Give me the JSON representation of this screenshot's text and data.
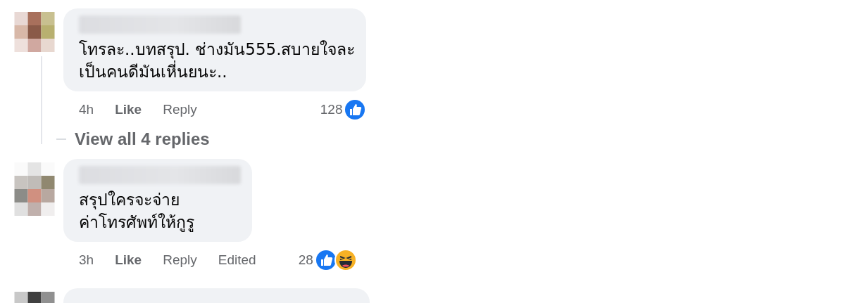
{
  "comments": [
    {
      "text_lines": [
        "โทรละ..บทสรุป. ช่างมัน555.สบายใจละ",
        "เป็นคนดีมันเหี่นยนะ.."
      ],
      "time": "4h",
      "like": "Like",
      "reply": "Reply",
      "reaction_count": "128",
      "reactions": [
        {
          "kind": "like"
        }
      ],
      "more_replies": "View all 4 replies"
    },
    {
      "text_lines": [
        "สรุปใครจะจ่าย",
        "ค่าโทรศัพท์ให้กูรู"
      ],
      "time": "3h",
      "like": "Like",
      "reply": "Reply",
      "edited": "Edited",
      "reaction_count": "28",
      "reactions": [
        {
          "kind": "like"
        },
        {
          "kind": "haha"
        }
      ]
    }
  ]
}
